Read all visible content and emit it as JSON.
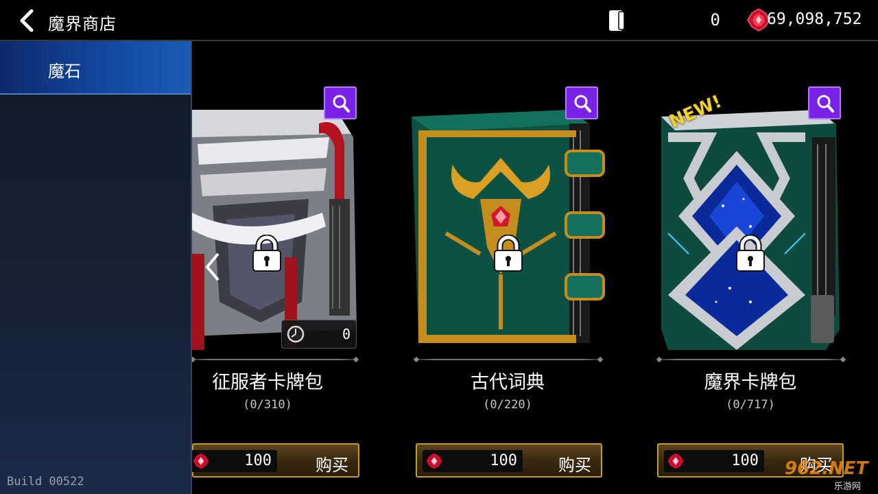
{
  "header": {
    "title": "魔界商店",
    "card_count": "0",
    "currency": "69,098,752"
  },
  "sidebar": {
    "tabs": [
      {
        "label": "魔石"
      }
    ],
    "build": "Build 00522"
  },
  "packs": [
    {
      "name": "征服者卡牌包",
      "progress": "(0/310)",
      "price": "100",
      "buy_label": "购买",
      "timer_value": "0",
      "locked": true
    },
    {
      "name": "古代词典",
      "progress": "(0/220)",
      "price": "100",
      "buy_label": "购买",
      "locked": true
    },
    {
      "name": "魔界卡牌包",
      "progress": "(0/717)",
      "price": "100",
      "buy_label": "购买",
      "badge": "NEW!",
      "locked": true
    }
  ],
  "watermark": {
    "main": "962.NET",
    "sub": "乐游网"
  },
  "colors": {
    "accent_purple": "#7a22e6",
    "sidebar_active": "#1348a0",
    "gold": "#c79a3e",
    "new_badge": "#f5d22a"
  },
  "icons": [
    "back-arrow-icon",
    "card-icon",
    "red-gem-icon",
    "lock-icon",
    "magnifier-icon",
    "timer-icon",
    "chevron-left-icon"
  ]
}
